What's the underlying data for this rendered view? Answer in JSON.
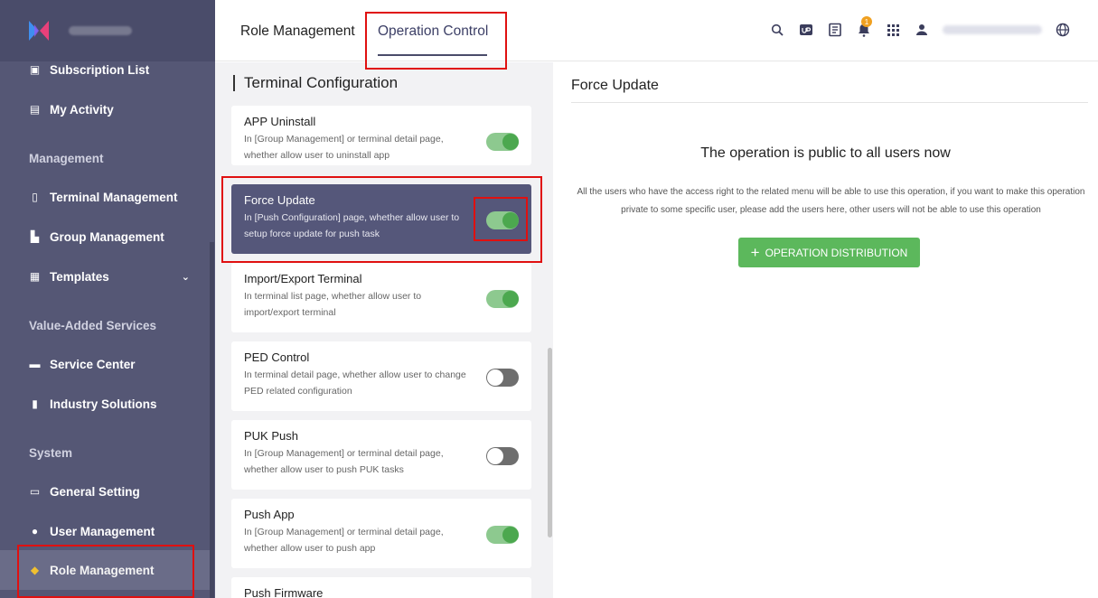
{
  "sidebar": {
    "items": [
      {
        "label": "Subscription List",
        "icon": "subscription-icon"
      },
      {
        "label": "My Activity",
        "icon": "activity-icon"
      },
      {
        "label": "Terminal Management",
        "icon": "terminal-icon"
      },
      {
        "label": "Group Management",
        "icon": "group-icon"
      },
      {
        "label": "Templates",
        "icon": "templates-icon"
      },
      {
        "label": "Service Center",
        "icon": "service-icon"
      },
      {
        "label": "Industry Solutions",
        "icon": "industry-icon"
      },
      {
        "label": "General Setting",
        "icon": "settings-icon"
      },
      {
        "label": "User Management",
        "icon": "user-icon"
      },
      {
        "label": "Role Management",
        "icon": "role-icon"
      }
    ],
    "sections": {
      "management": "Management",
      "value_added": "Value-Added Services",
      "system": "System"
    }
  },
  "header": {
    "tabs": [
      {
        "label": "Role Management"
      },
      {
        "label": "Operation Control"
      }
    ],
    "notification_count": "1"
  },
  "middle": {
    "title": "Terminal Configuration",
    "cards": [
      {
        "title": "APP Uninstall",
        "desc": "In [Group Management] or terminal detail page, whether allow user to uninstall app",
        "enabled": true
      },
      {
        "title": "Force Update",
        "desc": "In [Push Configuration] page, whether allow user to setup force update for push task",
        "enabled": true
      },
      {
        "title": "Import/Export Terminal",
        "desc": "In terminal list page, whether allow user to import/export terminal",
        "enabled": true
      },
      {
        "title": "PED Control",
        "desc": "In terminal detail page, whether allow user to change PED related configuration",
        "enabled": false
      },
      {
        "title": "PUK Push",
        "desc": "In [Group Management] or terminal detail page, whether allow user to push PUK tasks",
        "enabled": false
      },
      {
        "title": "Push App",
        "desc": "In [Group Management] or terminal detail page, whether allow user to push app",
        "enabled": true
      },
      {
        "title": "Push Firmware",
        "desc": "",
        "enabled": true
      }
    ]
  },
  "right": {
    "title": "Force Update",
    "heading": "The operation is public to all users now",
    "description": "All the users who have the access right to the related menu will be able to use this operation, if you want to make this operation private to some specific user, please add the users here, other users will not be able to use this operation",
    "button_label": "OPERATION DISTRIBUTION"
  },
  "colors": {
    "sidebar": "#555775",
    "accent_green": "#5cb85c",
    "selected_card": "#55577a",
    "highlight": "#e01010"
  }
}
